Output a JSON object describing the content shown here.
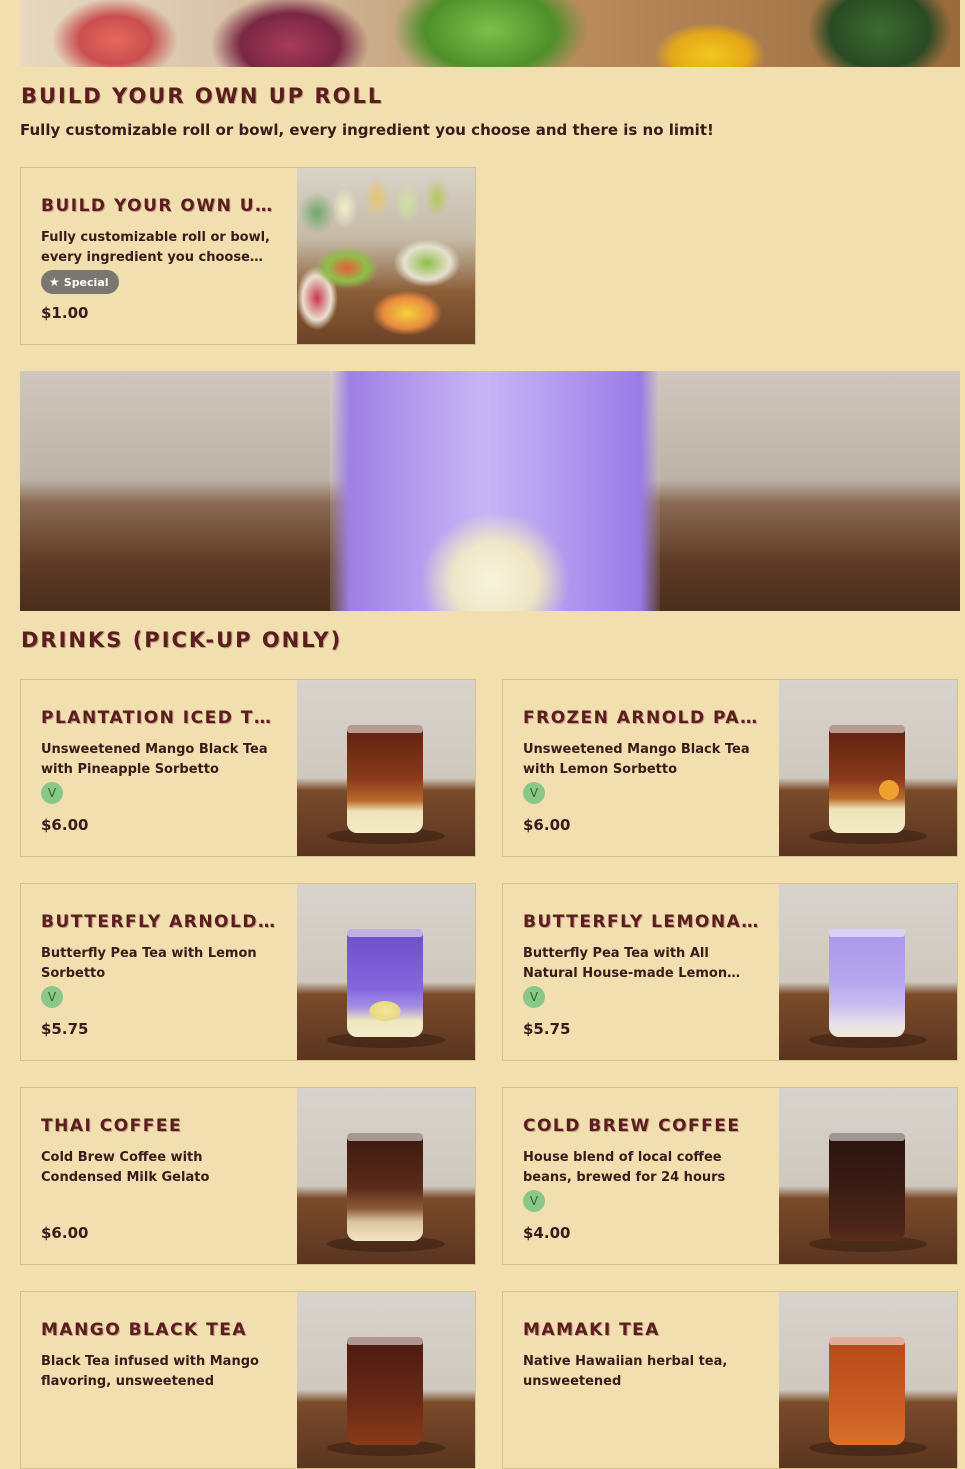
{
  "sections": {
    "roll": {
      "title": "Build Your Own UP Roll",
      "subtitle": "Fully customizable roll or bowl, every ingredient you choose and there is no limit!"
    },
    "drinks": {
      "title": "Drinks (Pick-up Only)"
    }
  },
  "roll_card": {
    "title": "Build Your Own UP Roll",
    "description": "Fully customizable roll or bowl, every ingredient you choose and there is no limit!",
    "badge": "Special",
    "badge_icon": "star-icon",
    "price": "$1.00"
  },
  "drinks": [
    {
      "title": "Plantation Iced Tea",
      "description": "Unsweetened Mango Black Tea with Pineapple Sorbetto",
      "veg": "V",
      "price": "$6.00"
    },
    {
      "title": "Frozen Arnold Palmer",
      "description": "Unsweetened Mango Black Tea with Lemon Sorbetto",
      "veg": "V",
      "price": "$6.00"
    },
    {
      "title": "Butterfly Arnold Palmer",
      "description": "Butterfly Pea Tea with Lemon Sorbetto",
      "veg": "V",
      "price": "$5.75"
    },
    {
      "title": "Butterfly Lemonade",
      "description": "Butterfly Pea Tea with All Natural House-made Lemon Syrup",
      "veg": "V",
      "price": "$5.75"
    },
    {
      "title": "Thai Coffee",
      "description": "Cold Brew Coffee with Condensed Milk Gelato",
      "veg": "",
      "price": "$6.00"
    },
    {
      "title": "Cold Brew Coffee",
      "description": "House blend of local coffee beans, brewed for 24 hours",
      "veg": "V",
      "price": "$4.00"
    },
    {
      "title": "Mango Black Tea",
      "description": "Black Tea infused with Mango flavoring, unsweetened",
      "veg": "",
      "price": ""
    },
    {
      "title": "Mamaki Tea",
      "description": "Native Hawaiian herbal tea, unsweetened",
      "veg": "",
      "price": ""
    }
  ],
  "colors": {
    "background": "#f1dfb0",
    "title": "#5a1f1c",
    "veg_badge": "#8cc78a",
    "special_badge": "#7a7670"
  }
}
